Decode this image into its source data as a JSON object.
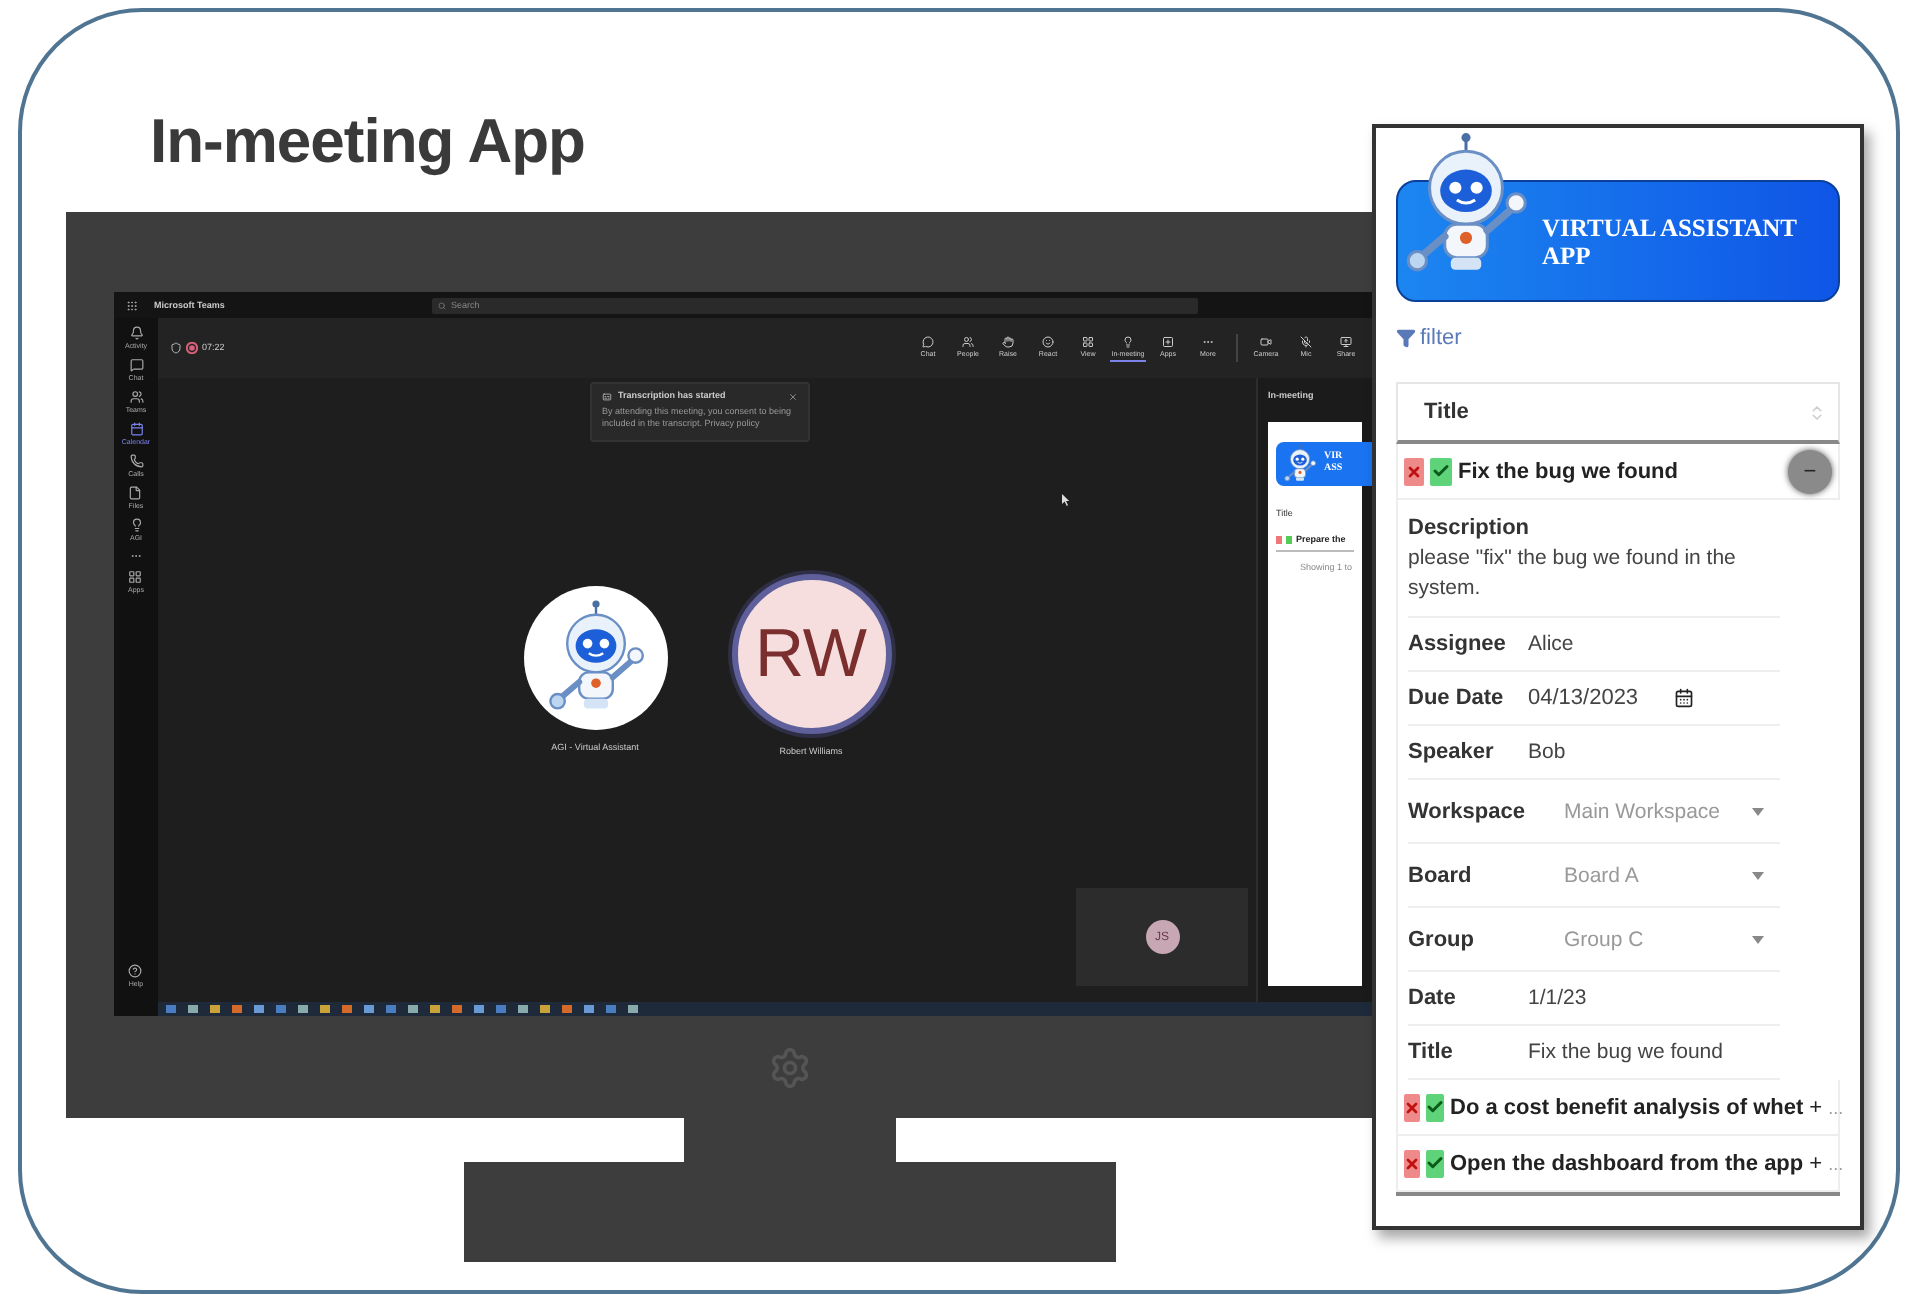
{
  "slide": {
    "title": "In-meeting App"
  },
  "teams": {
    "app_name": "Microsoft Teams",
    "search": {
      "placeholder": "Search"
    },
    "timer": "07:22",
    "rail": [
      {
        "label": "Activity",
        "selected": false
      },
      {
        "label": "Chat",
        "selected": false
      },
      {
        "label": "Teams",
        "selected": false
      },
      {
        "label": "Calendar",
        "selected": true
      },
      {
        "label": "Calls",
        "selected": false
      },
      {
        "label": "Files",
        "selected": false
      },
      {
        "label": "AGI",
        "selected": false
      },
      {
        "label": "Apps",
        "selected": false
      }
    ],
    "help": "Help",
    "toolbar": [
      {
        "label": "Chat",
        "selected": false
      },
      {
        "label": "People",
        "selected": false
      },
      {
        "label": "Raise",
        "selected": false
      },
      {
        "label": "React",
        "selected": false
      },
      {
        "label": "View",
        "selected": false
      },
      {
        "label": "In-meeting",
        "selected": true
      },
      {
        "label": "Apps",
        "selected": false
      },
      {
        "label": "More",
        "selected": false
      }
    ],
    "devices": [
      {
        "label": "Camera"
      },
      {
        "label": "Mic"
      },
      {
        "label": "Share"
      }
    ],
    "toast": {
      "title": "Transcription has started",
      "body": "By attending this meeting, you consent to being included in the transcript. Privacy policy"
    },
    "participants": [
      {
        "kind": "bot",
        "name": "AGI - Virtual Assistant"
      },
      {
        "kind": "initials",
        "initials": "RW",
        "name": "Robert Williams"
      }
    ],
    "self_tile": {
      "initials": "JS"
    },
    "side_panel": {
      "title": "In-meeting",
      "banner": [
        "VIR",
        "ASS"
      ],
      "column": "Title",
      "row": "Prepare the",
      "footer": "Showing 1 to"
    }
  },
  "app_panel": {
    "banner": "VIRTUAL ASSISTANT APP",
    "filter": "filter",
    "column": "Title",
    "tasks": [
      {
        "title": "Fix the bug we found",
        "expanded": true,
        "toggle": "−",
        "details": {
          "description_label": "Description",
          "description": "please \"fix\" the bug we found in the system.",
          "fields": [
            {
              "kind": "text",
              "label": "Assignee",
              "value": "Alice"
            },
            {
              "kind": "date",
              "label": "Due Date",
              "value": "04/13/2023"
            },
            {
              "kind": "text",
              "label": "Speaker",
              "value": "Bob"
            },
            {
              "kind": "select",
              "label": "Workspace",
              "value": "Main Workspace"
            },
            {
              "kind": "select",
              "label": "Board",
              "value": "Board A"
            },
            {
              "kind": "select",
              "label": "Group",
              "value": "Group C"
            },
            {
              "kind": "text",
              "label": "Date",
              "value": "1/1/23"
            },
            {
              "kind": "text",
              "label": "Title",
              "value": "Fix the bug we found"
            }
          ]
        }
      },
      {
        "title": "Do a cost benefit analysis of whet",
        "expanded": false,
        "toggle": "+",
        "more": "..."
      },
      {
        "title": "Open the dashboard from the app",
        "expanded": false,
        "toggle": "+",
        "more": "..."
      }
    ]
  }
}
